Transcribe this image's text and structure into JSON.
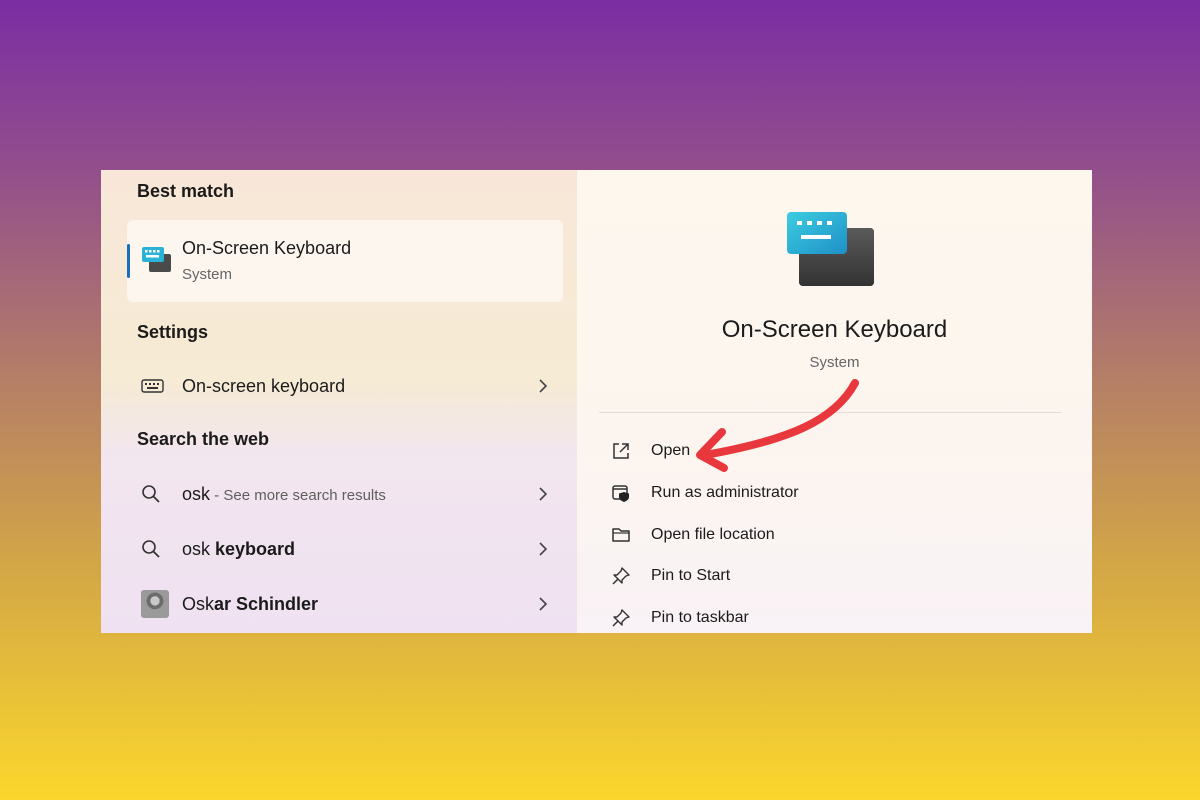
{
  "left": {
    "best_match_title": "Best match",
    "best_match": {
      "title": "On-Screen Keyboard",
      "subtitle": "System",
      "icon": "osk-app-icon"
    },
    "settings_title": "Settings",
    "settings_item": {
      "label": "On-screen keyboard",
      "icon": "keyboard-icon"
    },
    "web_title": "Search the web",
    "web_items": [
      {
        "prefix": "osk",
        "suffix": " - See more search results",
        "icon": "search-icon"
      },
      {
        "prefix": "osk ",
        "bold": "keyboard",
        "icon": "search-icon"
      },
      {
        "prefix": "Osk",
        "bold": "ar Schindler",
        "icon": "avatar"
      }
    ]
  },
  "right": {
    "title": "On-Screen Keyboard",
    "subtitle": "System",
    "actions": [
      {
        "label": "Open",
        "icon": "open-external-icon"
      },
      {
        "label": "Run as administrator",
        "icon": "shield-admin-icon"
      },
      {
        "label": "Open file location",
        "icon": "folder-icon"
      },
      {
        "label": "Pin to Start",
        "icon": "pin-icon"
      },
      {
        "label": "Pin to taskbar",
        "icon": "pin-icon"
      }
    ]
  },
  "colors": {
    "accent": "#1a6ec0",
    "annotation_arrow": "#e8383d"
  }
}
